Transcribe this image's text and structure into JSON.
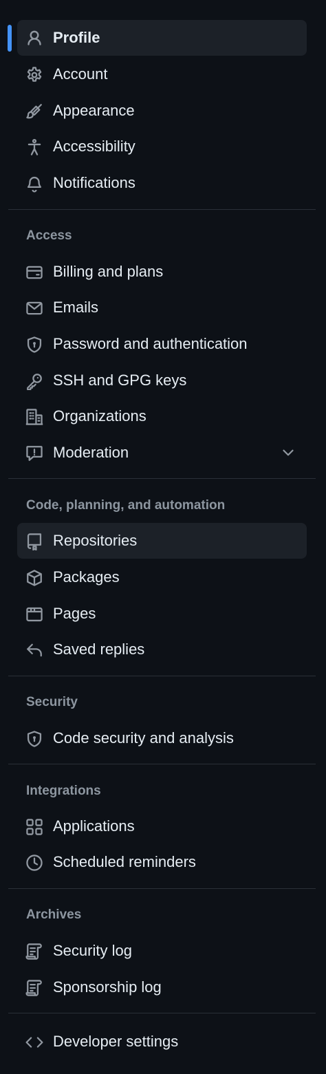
{
  "nav": {
    "top_items": [
      {
        "label": "Profile",
        "icon": "person-icon",
        "selected": true
      },
      {
        "label": "Account",
        "icon": "gear-icon"
      },
      {
        "label": "Appearance",
        "icon": "paintbrush-icon"
      },
      {
        "label": "Accessibility",
        "icon": "accessibility-icon"
      },
      {
        "label": "Notifications",
        "icon": "bell-icon"
      }
    ],
    "sections": [
      {
        "heading": "Access",
        "items": [
          {
            "label": "Billing and plans",
            "icon": "credit-card-icon"
          },
          {
            "label": "Emails",
            "icon": "mail-icon"
          },
          {
            "label": "Password and authentication",
            "icon": "shield-lock-icon"
          },
          {
            "label": "SSH and GPG keys",
            "icon": "key-icon"
          },
          {
            "label": "Organizations",
            "icon": "organization-icon"
          },
          {
            "label": "Moderation",
            "icon": "report-icon",
            "expandable": true
          }
        ]
      },
      {
        "heading": "Code, planning, and automation",
        "items": [
          {
            "label": "Repositories",
            "icon": "repo-icon",
            "highlighted": true
          },
          {
            "label": "Packages",
            "icon": "package-icon"
          },
          {
            "label": "Pages",
            "icon": "browser-icon"
          },
          {
            "label": "Saved replies",
            "icon": "reply-icon"
          }
        ]
      },
      {
        "heading": "Security",
        "items": [
          {
            "label": "Code security and analysis",
            "icon": "shield-lock-icon"
          }
        ]
      },
      {
        "heading": "Integrations",
        "items": [
          {
            "label": "Applications",
            "icon": "apps-icon"
          },
          {
            "label": "Scheduled reminders",
            "icon": "clock-icon"
          }
        ]
      },
      {
        "heading": "Archives",
        "items": [
          {
            "label": "Security log",
            "icon": "log-icon"
          },
          {
            "label": "Sponsorship log",
            "icon": "log-icon"
          }
        ]
      }
    ],
    "bottom_items": [
      {
        "label": "Developer settings",
        "icon": "code-icon"
      }
    ]
  },
  "colors": {
    "background": "#0d1117",
    "selected_background": "#1c2128",
    "accent": "#4493f8",
    "text": "#e6edf3",
    "muted": "#8d96a0",
    "divider": "#2a3038"
  }
}
